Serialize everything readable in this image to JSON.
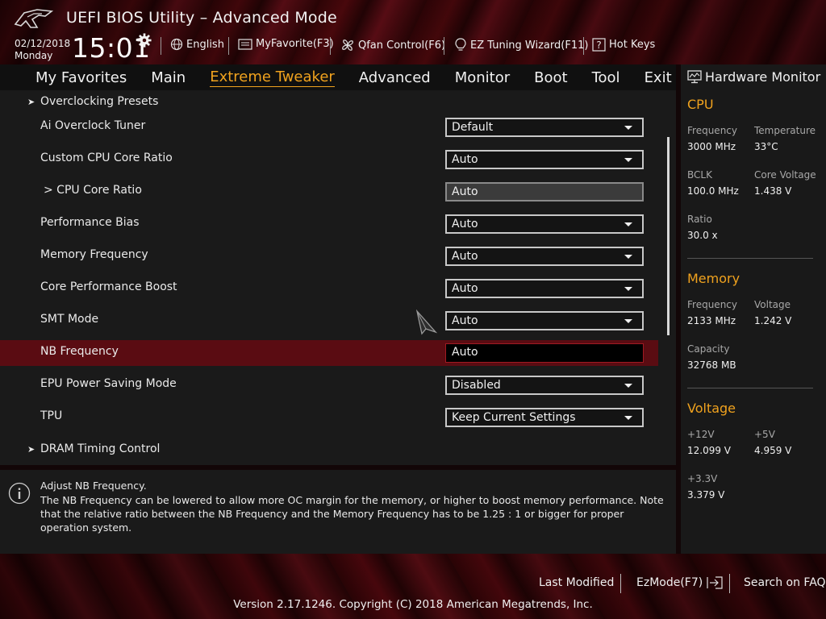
{
  "header": {
    "title": "UEFI BIOS Utility – Advanced Mode",
    "date": "02/12/2018",
    "day": "Monday",
    "time": "15:01",
    "buttons": [
      {
        "label": "English",
        "icon": "globe-icon"
      },
      {
        "label": "MyFavorite(F3)",
        "icon": "favorite-list-icon"
      },
      {
        "label": "Qfan Control(F6)",
        "icon": "fan-icon"
      },
      {
        "label": "EZ Tuning Wizard(F11)",
        "icon": "lightbulb-icon"
      },
      {
        "label": "Hot Keys",
        "icon": "question-key-icon"
      }
    ]
  },
  "tabs": [
    {
      "label": "My Favorites"
    },
    {
      "label": "Main"
    },
    {
      "label": "Extreme Tweaker",
      "active": true
    },
    {
      "label": "Advanced"
    },
    {
      "label": "Monitor"
    },
    {
      "label": "Boot"
    },
    {
      "label": "Tool"
    },
    {
      "label": "Exit"
    }
  ],
  "settings": {
    "overclocking_presets": "Overclocking Presets",
    "ai_overclock_tuner": {
      "label": "Ai Overclock Tuner",
      "value": "Default"
    },
    "custom_cpu_core_ratio": {
      "label": "Custom CPU Core Ratio",
      "value": "Auto"
    },
    "cpu_core_ratio": {
      "label": "> CPU Core Ratio",
      "value": "Auto"
    },
    "performance_bias": {
      "label": "Performance Bias",
      "value": "Auto"
    },
    "memory_frequency": {
      "label": "Memory Frequency",
      "value": "Auto"
    },
    "core_performance_boost": {
      "label": "Core Performance Boost",
      "value": "Auto"
    },
    "smt_mode": {
      "label": "SMT Mode",
      "value": "Auto"
    },
    "nb_frequency": {
      "label": "NB Frequency",
      "value": "Auto"
    },
    "epu_power_saving": {
      "label": "EPU Power Saving Mode",
      "value": "Disabled"
    },
    "tpu": {
      "label": "TPU",
      "value": "Keep Current Settings"
    },
    "dram_timing_control": "DRAM Timing Control"
  },
  "help": {
    "title": "Adjust NB Frequency.",
    "text": "The NB Frequency can be lowered to allow more OC margin for the memory, or higher to boost memory performance.  Note that the relative ratio between the NB Frequency and the Memory Frequency has to be 1.25 : 1 or bigger for proper operation system."
  },
  "hardware_monitor": {
    "title": "Hardware Monitor",
    "cpu": {
      "heading": "CPU",
      "frequency_label": "Frequency",
      "frequency": "3000 MHz",
      "temperature_label": "Temperature",
      "temperature": "33°C",
      "bclk_label": "BCLK",
      "bclk": "100.0 MHz",
      "core_voltage_label": "Core Voltage",
      "core_voltage": "1.438 V",
      "ratio_label": "Ratio",
      "ratio": "30.0 x"
    },
    "memory": {
      "heading": "Memory",
      "frequency_label": "Frequency",
      "frequency": "2133 MHz",
      "voltage_label": "Voltage",
      "voltage": "1.242 V",
      "capacity_label": "Capacity",
      "capacity": "32768 MB"
    },
    "voltage": {
      "heading": "Voltage",
      "v12_label": "+12V",
      "v12": "12.099 V",
      "v5_label": "+5V",
      "v5": "4.959 V",
      "v33_label": "+3.3V",
      "v33": "3.379 V"
    }
  },
  "footer": {
    "last_modified": "Last Modified",
    "ezmode": "EzMode(F7)",
    "search_faq": "Search on FAQ",
    "copyright": "Version 2.17.1246. Copyright (C) 2018 American Megatrends, Inc."
  },
  "colors": {
    "accent": "#f0a21e",
    "highlight_row": "#5a0c12",
    "panel": "#1a1a1a"
  }
}
